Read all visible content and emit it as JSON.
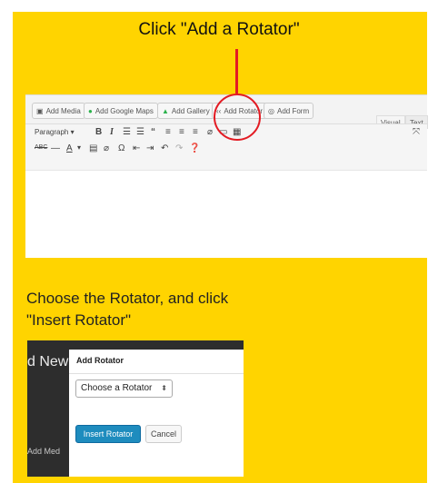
{
  "captions": {
    "top": "Click \"Add a Rotator\"",
    "middle_line1": "Choose the Rotator, and click",
    "middle_line2": "\"Insert Rotator\""
  },
  "colors": {
    "background_yellow": "#FFD400",
    "arrow_red": "#e31b23",
    "primary_blue": "#1e8cbe"
  },
  "editor": {
    "media_buttons": [
      {
        "label": "Add Media",
        "icon": "media-icon"
      },
      {
        "label": "Add Google Maps",
        "icon": "map-pin-icon"
      },
      {
        "label": "Add Gallery",
        "icon": "gallery-icon"
      },
      {
        "label": "Add Rotator",
        "icon": "rotator-icon"
      },
      {
        "label": "Add Form",
        "icon": "form-icon"
      }
    ],
    "tabs": {
      "visual": "Visual",
      "text": "Text"
    },
    "toolbar": {
      "format_select": "Paragraph",
      "row1_icons": [
        "bold-icon",
        "italic-icon",
        "bullet-list-icon",
        "numbered-list-icon",
        "blockquote-icon",
        "align-left-icon",
        "align-center-icon",
        "align-right-icon",
        "link-icon",
        "insert-more-icon",
        "toolbar-toggle-icon"
      ],
      "row2_icons": [
        "strikethrough-icon",
        "horizontal-line-icon",
        "text-color-icon",
        "paste-text-icon",
        "clear-formatting-icon",
        "special-character-icon",
        "outdent-icon",
        "indent-icon",
        "undo-icon",
        "redo-icon",
        "help-icon"
      ],
      "fullscreen_icon": "fullscreen-icon"
    }
  },
  "dialog_section": {
    "background_title_fragment": "d New",
    "background_button_fragment": "Add Med",
    "dialog": {
      "title": "Add Rotator",
      "select_value": "Choose a Rotator",
      "insert_label": "Insert Rotator",
      "cancel_label": "Cancel"
    }
  }
}
